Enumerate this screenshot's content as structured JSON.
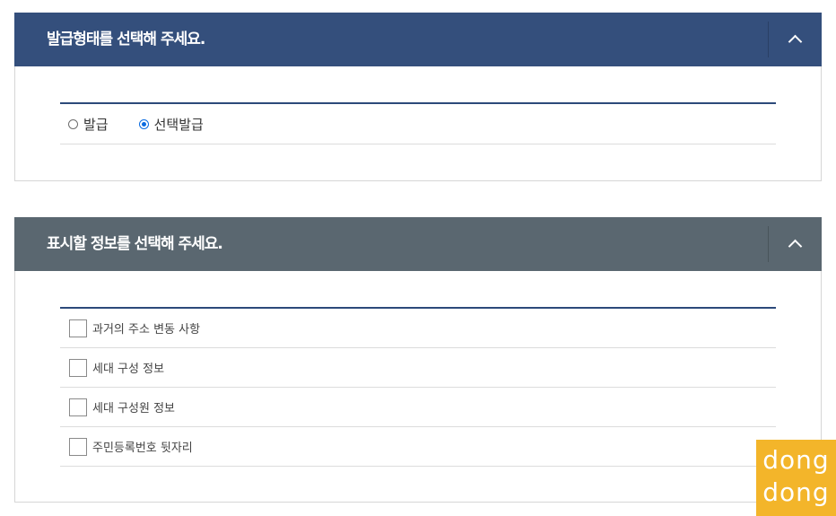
{
  "issue_type_panel": {
    "title": "발급형태를 선택해 주세요.",
    "options": [
      {
        "label": "발급",
        "selected": false
      },
      {
        "label": "선택발급",
        "selected": true
      }
    ]
  },
  "display_info_panel": {
    "title": "표시할 정보를 선택해 주세요.",
    "items": [
      {
        "label": "과거의 주소 변동 사항",
        "checked": false
      },
      {
        "label": "세대 구성 정보",
        "checked": false
      },
      {
        "label": "세대 구성원 정보",
        "checked": false
      },
      {
        "label": "주민등록번호 뒷자리",
        "checked": false
      }
    ]
  },
  "watermark": {
    "line1": "dong",
    "line2": "dong"
  },
  "colors": {
    "panel1_header": "#344f7c",
    "panel2_header": "#5a6770",
    "content_top_border": "#2c4a7a",
    "radio_accent": "#0a6be0",
    "watermark_bg": "#f3b52a"
  },
  "icons": {
    "collapse": "chevron-up-icon"
  }
}
